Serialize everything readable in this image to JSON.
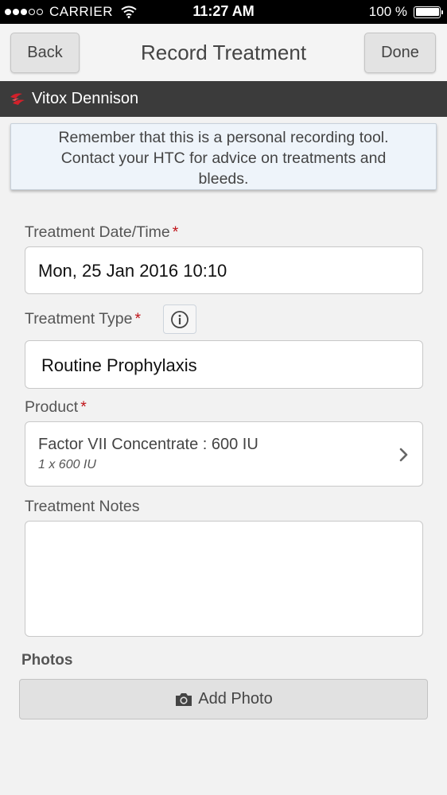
{
  "status_bar": {
    "carrier": "CARRIER",
    "time": "11:27 AM",
    "battery": "100 %",
    "signal_bars": 3
  },
  "nav": {
    "back_label": "Back",
    "title": "Record Treatment",
    "done_label": "Done"
  },
  "patient": {
    "name": "Vitox Dennison"
  },
  "notice": {
    "line1": "Remember that this is a personal recording tool.",
    "line2": "Contact your HTC for advice on treatments and",
    "line3": "bleeds."
  },
  "form": {
    "date_label": "Treatment Date/Time",
    "date_value": "Mon, 25 Jan 2016 10:10",
    "type_label": "Treatment Type",
    "type_value": "Routine Prophylaxis",
    "product_label": "Product",
    "product_name": "Factor VII Concentrate : 600 IU",
    "product_qty": "1 x 600 IU",
    "notes_label": "Treatment Notes",
    "notes_value": "",
    "required_mark": "*"
  },
  "photos": {
    "label": "Photos",
    "add_label": "Add Photo"
  },
  "colors": {
    "patient_bar": "#3b3b3b",
    "required": "#c0151a",
    "notice_bg": "#eef4fa"
  }
}
